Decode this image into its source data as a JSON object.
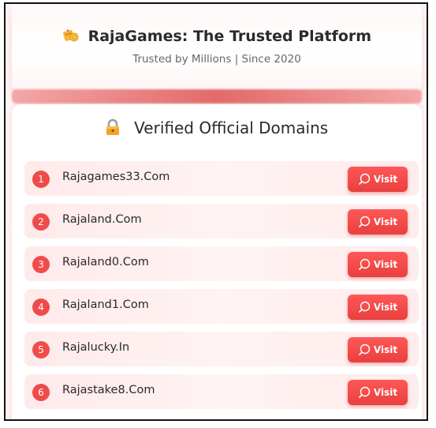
{
  "header": {
    "title": "RajaGames: The Trusted Platform",
    "subtitle": "Trusted by Millions | Since 2020",
    "logo_icon": "coins-gift-icon"
  },
  "section": {
    "title": "Verified Official Domains",
    "icon": "lock-icon"
  },
  "domains": [
    {
      "number": "1",
      "name": "Rajagames33.Com",
      "button_label": "Visit"
    },
    {
      "number": "2",
      "name": "Rajaland.Com",
      "button_label": "Visit"
    },
    {
      "number": "3",
      "name": "Rajaland0.Com",
      "button_label": "Visit"
    },
    {
      "number": "4",
      "name": "Rajaland1.Com",
      "button_label": "Visit"
    },
    {
      "number": "5",
      "name": "Rajalucky.In",
      "button_label": "Visit"
    },
    {
      "number": "6",
      "name": "Rajastake8.Com",
      "button_label": "Visit"
    }
  ],
  "colors": {
    "accent": "#f04b4b",
    "row_background": "#ffeaea",
    "text": "#2a2a2a"
  }
}
